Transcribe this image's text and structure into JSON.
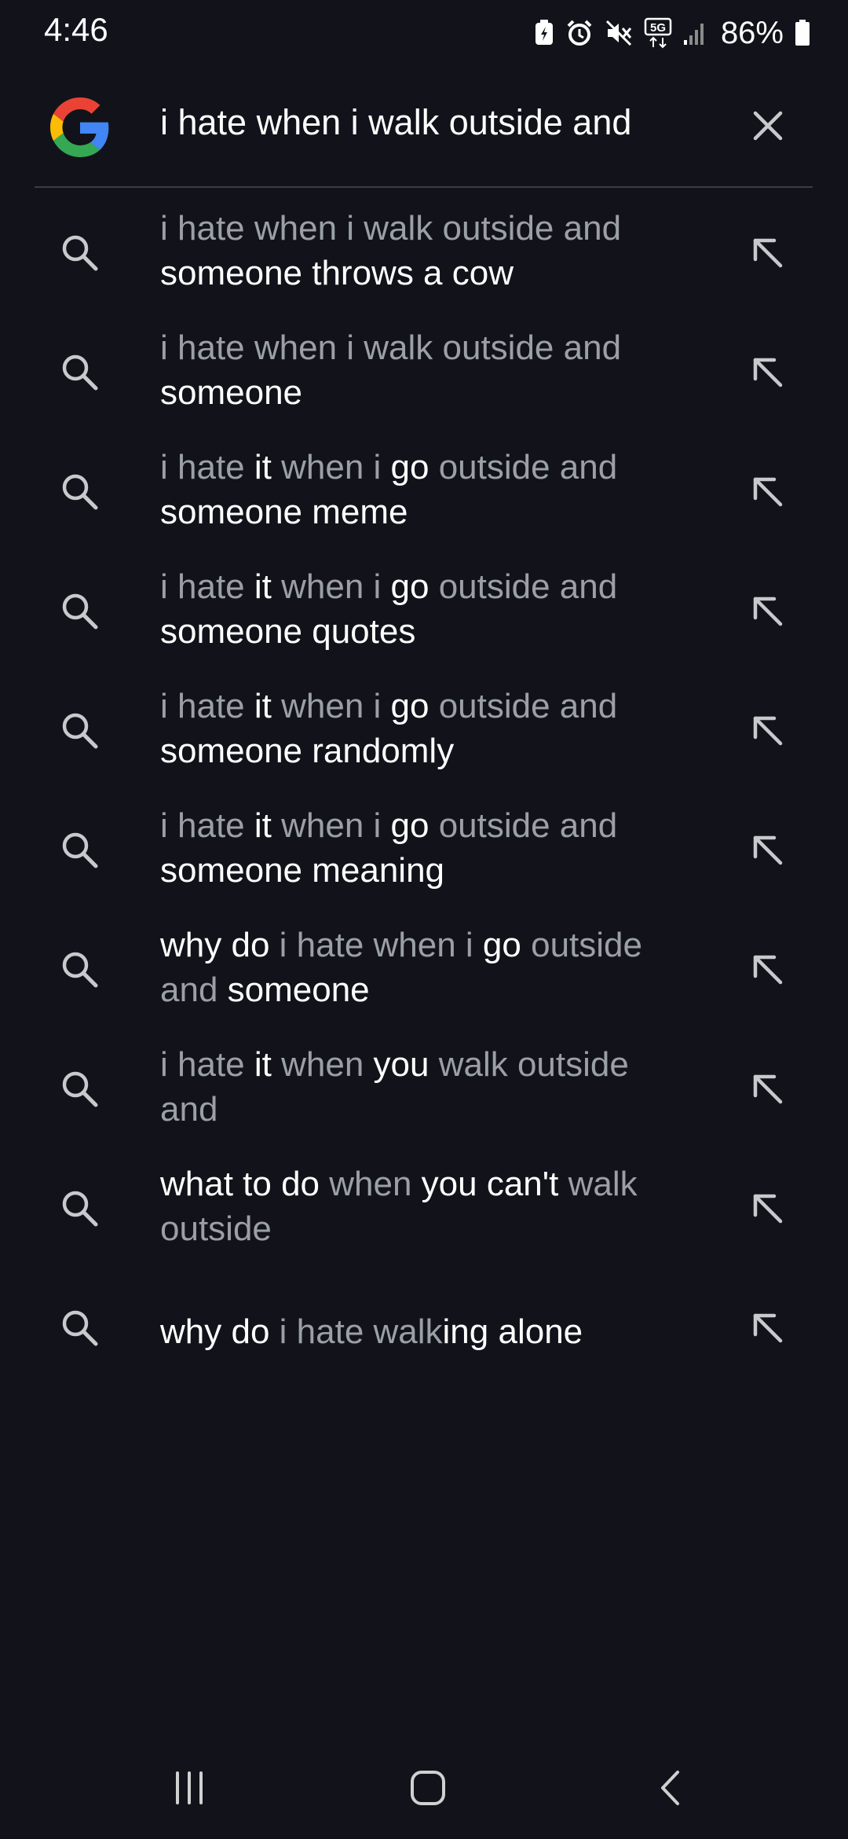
{
  "status_bar": {
    "time": "4:46",
    "battery_percent": "86%",
    "icons": [
      "battery-saver-icon",
      "alarm-icon",
      "mute-icon",
      "5g-icon",
      "signal-icon",
      "battery-icon"
    ]
  },
  "search": {
    "query": "i hate when i walk outside and",
    "clear_icon": "close-icon",
    "logo": "google-logo"
  },
  "suggestions": [
    {
      "segments": [
        {
          "t": "i hate when i walk outside and ",
          "b": false
        },
        {
          "t": "someone throws a cow",
          "b": true
        }
      ]
    },
    {
      "segments": [
        {
          "t": "i hate when i walk outside and ",
          "b": false
        },
        {
          "t": "someone",
          "b": true
        }
      ]
    },
    {
      "segments": [
        {
          "t": "i hate ",
          "b": false
        },
        {
          "t": "it",
          "b": true
        },
        {
          "t": " when i ",
          "b": false
        },
        {
          "t": "go",
          "b": true
        },
        {
          "t": " outside and ",
          "b": false
        },
        {
          "t": "someone meme",
          "b": true
        }
      ]
    },
    {
      "segments": [
        {
          "t": "i hate ",
          "b": false
        },
        {
          "t": "it",
          "b": true
        },
        {
          "t": " when i ",
          "b": false
        },
        {
          "t": "go",
          "b": true
        },
        {
          "t": " outside and ",
          "b": false
        },
        {
          "t": "someone quotes",
          "b": true
        }
      ]
    },
    {
      "segments": [
        {
          "t": "i hate ",
          "b": false
        },
        {
          "t": "it",
          "b": true
        },
        {
          "t": " when i ",
          "b": false
        },
        {
          "t": "go",
          "b": true
        },
        {
          "t": " outside and ",
          "b": false
        },
        {
          "t": "someone randomly",
          "b": true
        }
      ]
    },
    {
      "segments": [
        {
          "t": "i hate ",
          "b": false
        },
        {
          "t": "it",
          "b": true
        },
        {
          "t": " when i ",
          "b": false
        },
        {
          "t": "go",
          "b": true
        },
        {
          "t": " outside and ",
          "b": false
        },
        {
          "t": "someone meaning",
          "b": true
        }
      ]
    },
    {
      "segments": [
        {
          "t": "why do",
          "b": true
        },
        {
          "t": " i hate when i ",
          "b": false
        },
        {
          "t": "go",
          "b": true
        },
        {
          "t": " outside and ",
          "b": false
        },
        {
          "t": "someone",
          "b": true
        }
      ]
    },
    {
      "segments": [
        {
          "t": "i hate ",
          "b": false
        },
        {
          "t": "it",
          "b": true
        },
        {
          "t": " when ",
          "b": false
        },
        {
          "t": "you",
          "b": true
        },
        {
          "t": " walk outside and",
          "b": false
        }
      ]
    },
    {
      "segments": [
        {
          "t": "what to do",
          "b": true
        },
        {
          "t": " when ",
          "b": false
        },
        {
          "t": "you can't",
          "b": true
        },
        {
          "t": " walk outside",
          "b": false
        }
      ]
    },
    {
      "segments": [
        {
          "t": "why do",
          "b": true
        },
        {
          "t": " i hate walk",
          "b": false
        },
        {
          "t": "ing alone",
          "b": true
        }
      ],
      "single": true
    }
  ],
  "suggestion_icons": {
    "leading": "search-icon",
    "trailing": "fill-query-arrow-icon"
  },
  "nav_bar": {
    "icons": [
      "recents-icon",
      "home-icon",
      "back-icon"
    ]
  }
}
